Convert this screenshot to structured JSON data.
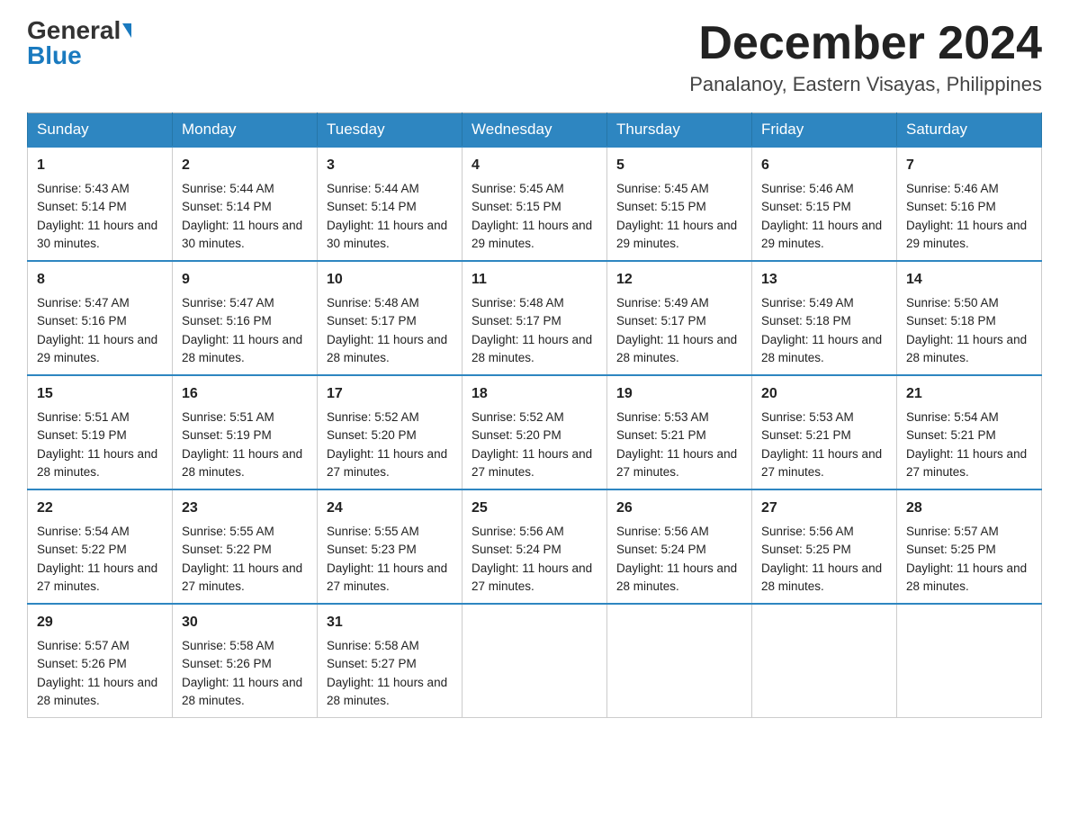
{
  "header": {
    "logo_general": "General",
    "logo_blue": "Blue",
    "month_title": "December 2024",
    "location": "Panalanoy, Eastern Visayas, Philippines"
  },
  "weekdays": [
    "Sunday",
    "Monday",
    "Tuesday",
    "Wednesday",
    "Thursday",
    "Friday",
    "Saturday"
  ],
  "weeks": [
    [
      {
        "day": "1",
        "sunrise": "5:43 AM",
        "sunset": "5:14 PM",
        "daylight": "11 hours and 30 minutes."
      },
      {
        "day": "2",
        "sunrise": "5:44 AM",
        "sunset": "5:14 PM",
        "daylight": "11 hours and 30 minutes."
      },
      {
        "day": "3",
        "sunrise": "5:44 AM",
        "sunset": "5:14 PM",
        "daylight": "11 hours and 30 minutes."
      },
      {
        "day": "4",
        "sunrise": "5:45 AM",
        "sunset": "5:15 PM",
        "daylight": "11 hours and 29 minutes."
      },
      {
        "day": "5",
        "sunrise": "5:45 AM",
        "sunset": "5:15 PM",
        "daylight": "11 hours and 29 minutes."
      },
      {
        "day": "6",
        "sunrise": "5:46 AM",
        "sunset": "5:15 PM",
        "daylight": "11 hours and 29 minutes."
      },
      {
        "day": "7",
        "sunrise": "5:46 AM",
        "sunset": "5:16 PM",
        "daylight": "11 hours and 29 minutes."
      }
    ],
    [
      {
        "day": "8",
        "sunrise": "5:47 AM",
        "sunset": "5:16 PM",
        "daylight": "11 hours and 29 minutes."
      },
      {
        "day": "9",
        "sunrise": "5:47 AM",
        "sunset": "5:16 PM",
        "daylight": "11 hours and 28 minutes."
      },
      {
        "day": "10",
        "sunrise": "5:48 AM",
        "sunset": "5:17 PM",
        "daylight": "11 hours and 28 minutes."
      },
      {
        "day": "11",
        "sunrise": "5:48 AM",
        "sunset": "5:17 PM",
        "daylight": "11 hours and 28 minutes."
      },
      {
        "day": "12",
        "sunrise": "5:49 AM",
        "sunset": "5:17 PM",
        "daylight": "11 hours and 28 minutes."
      },
      {
        "day": "13",
        "sunrise": "5:49 AM",
        "sunset": "5:18 PM",
        "daylight": "11 hours and 28 minutes."
      },
      {
        "day": "14",
        "sunrise": "5:50 AM",
        "sunset": "5:18 PM",
        "daylight": "11 hours and 28 minutes."
      }
    ],
    [
      {
        "day": "15",
        "sunrise": "5:51 AM",
        "sunset": "5:19 PM",
        "daylight": "11 hours and 28 minutes."
      },
      {
        "day": "16",
        "sunrise": "5:51 AM",
        "sunset": "5:19 PM",
        "daylight": "11 hours and 28 minutes."
      },
      {
        "day": "17",
        "sunrise": "5:52 AM",
        "sunset": "5:20 PM",
        "daylight": "11 hours and 27 minutes."
      },
      {
        "day": "18",
        "sunrise": "5:52 AM",
        "sunset": "5:20 PM",
        "daylight": "11 hours and 27 minutes."
      },
      {
        "day": "19",
        "sunrise": "5:53 AM",
        "sunset": "5:21 PM",
        "daylight": "11 hours and 27 minutes."
      },
      {
        "day": "20",
        "sunrise": "5:53 AM",
        "sunset": "5:21 PM",
        "daylight": "11 hours and 27 minutes."
      },
      {
        "day": "21",
        "sunrise": "5:54 AM",
        "sunset": "5:21 PM",
        "daylight": "11 hours and 27 minutes."
      }
    ],
    [
      {
        "day": "22",
        "sunrise": "5:54 AM",
        "sunset": "5:22 PM",
        "daylight": "11 hours and 27 minutes."
      },
      {
        "day": "23",
        "sunrise": "5:55 AM",
        "sunset": "5:22 PM",
        "daylight": "11 hours and 27 minutes."
      },
      {
        "day": "24",
        "sunrise": "5:55 AM",
        "sunset": "5:23 PM",
        "daylight": "11 hours and 27 minutes."
      },
      {
        "day": "25",
        "sunrise": "5:56 AM",
        "sunset": "5:24 PM",
        "daylight": "11 hours and 27 minutes."
      },
      {
        "day": "26",
        "sunrise": "5:56 AM",
        "sunset": "5:24 PM",
        "daylight": "11 hours and 28 minutes."
      },
      {
        "day": "27",
        "sunrise": "5:56 AM",
        "sunset": "5:25 PM",
        "daylight": "11 hours and 28 minutes."
      },
      {
        "day": "28",
        "sunrise": "5:57 AM",
        "sunset": "5:25 PM",
        "daylight": "11 hours and 28 minutes."
      }
    ],
    [
      {
        "day": "29",
        "sunrise": "5:57 AM",
        "sunset": "5:26 PM",
        "daylight": "11 hours and 28 minutes."
      },
      {
        "day": "30",
        "sunrise": "5:58 AM",
        "sunset": "5:26 PM",
        "daylight": "11 hours and 28 minutes."
      },
      {
        "day": "31",
        "sunrise": "5:58 AM",
        "sunset": "5:27 PM",
        "daylight": "11 hours and 28 minutes."
      },
      null,
      null,
      null,
      null
    ]
  ]
}
